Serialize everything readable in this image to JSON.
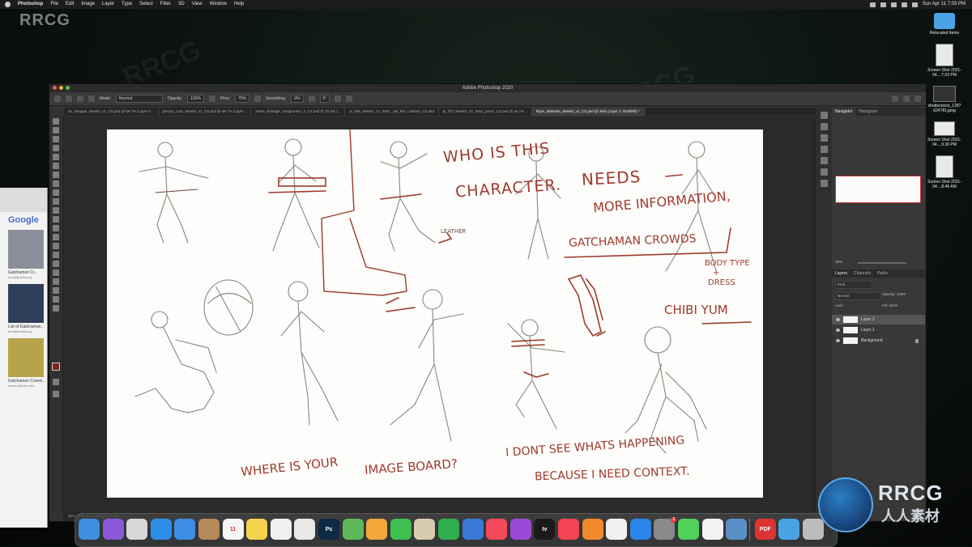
{
  "menubar": {
    "app_name": "Photoshop",
    "items": [
      "File",
      "Edit",
      "Image",
      "Layer",
      "Type",
      "Select",
      "Filter",
      "3D",
      "View",
      "Window",
      "Help"
    ],
    "clock": "Sun Apr 11  7:03 PM"
  },
  "watermark": {
    "corner": "RRCG",
    "repeat": "RRCG"
  },
  "desktop": {
    "icons": [
      {
        "label": "Relocated Items",
        "kind": "folder"
      },
      {
        "label": "Screen Shot 2021-04....7.03 PM",
        "kind": "image"
      },
      {
        "label": "shutterstock_1287 624781.jpeg",
        "kind": "image"
      },
      {
        "label": "Screen Shot 2021-04....9.36 PM",
        "kind": "image"
      },
      {
        "label": "Screen Shot 2021-04....8.46 AM",
        "kind": "image"
      }
    ]
  },
  "browser": {
    "logo": "Google",
    "results": [
      {
        "title": "Gatchaman Cr...",
        "source": "en.wikipedia.org"
      },
      {
        "title": "List of Gatchaman...",
        "source": "en.wikipedia.org"
      },
      {
        "title": "Gatchaman Crowd...",
        "source": "anime-planet.com"
      }
    ]
  },
  "photoshop": {
    "window_title": "Adobe Photoshop 2020",
    "options": {
      "mode_label": "Mode:",
      "mode_value": "Normal",
      "opacity_label": "Opacity:",
      "opacity_value": "100%",
      "flow_label": "Flow:",
      "flow_value": "75%",
      "smoothing_label": "Smoothing:",
      "smoothing_value": "0%",
      "angle_value": "0°"
    },
    "tabs": [
      {
        "label": "4a_Reagan_Week2_v1_CS.psd @ 66.7% (Layer 0...",
        "active": false
      },
      {
        "label": "jessica_Lara_Week2_v1_CS.psd @ 66.7% (Layer...",
        "active": false
      },
      {
        "label": "Jesse_Eldridge_Assignment_4_CS.psd @ 33.3% (...",
        "active": false
      },
      {
        "label": "je_Ella_Week2_V1_0001_call_this_Untitled_CS.psd",
        "active": false
      },
      {
        "label": "je_Ohi_Week2_V1_0001_jason_CS.psd @ 66.7%...",
        "active": false
      },
      {
        "label": "Ryan_Makaela_Week2_v1_CS.psd @ 39% (Layer 2, RGB/8#) *",
        "active": true
      }
    ],
    "status": "39%      1944 px x 1944 px (72 ppi)",
    "panels": {
      "top_tabs": [
        "Navigator",
        "Histogram"
      ],
      "zoom_value": "39%",
      "layer_tabs": [
        "Layers",
        "Channels",
        "Paths"
      ],
      "kind_label": "Kind",
      "blend_mode": "Normal",
      "opacity_label": "Opacity:",
      "opacity_value": "100%",
      "lock_label": "Lock:",
      "fill_label": "Fill:",
      "fill_value": "100%",
      "layers": [
        {
          "name": "Layer 2",
          "selected": true
        },
        {
          "name": "Layer 1",
          "selected": false
        },
        {
          "name": "Background",
          "selected": false
        }
      ]
    }
  },
  "canvas": {
    "notes": [
      "WHO IS THIS",
      "CHARACTER.",
      "NEEDS",
      "MORE INFORMATION,",
      "GATCHAMAN CROWDS",
      "BODY TYPE",
      "+",
      "DRESS",
      "CHIBI YUM",
      "LEATHER",
      "WHERE IS YOUR",
      "IMAGE BOARD?",
      "I DONT SEE WHATS HAPPENING",
      "BECAUSE I NEED CONTEXT."
    ],
    "ink_color": "#9e3a2c",
    "sketch_color": "#8a8580"
  },
  "dock": {
    "apps": [
      {
        "name": "finder-icon",
        "glyph": "",
        "color": "#3d8fe0"
      },
      {
        "name": "siri-icon",
        "glyph": "",
        "color": "#8a5ad8"
      },
      {
        "name": "launchpad-icon",
        "glyph": "",
        "color": "#d7d7d7"
      },
      {
        "name": "safari-icon",
        "glyph": "",
        "color": "#2e8fe8"
      },
      {
        "name": "mail-icon",
        "glyph": "",
        "color": "#3c8ee8"
      },
      {
        "name": "contacts-icon",
        "glyph": "",
        "color": "#b48a5a"
      },
      {
        "name": "calendar-icon",
        "glyph": "11",
        "color": "#f5f5f5"
      },
      {
        "name": "notes-icon",
        "glyph": "",
        "color": "#f4d34c"
      },
      {
        "name": "reminders-icon",
        "glyph": "",
        "color": "#f0f0f0"
      },
      {
        "name": "chrome-icon",
        "glyph": "",
        "color": "#e8e8e8"
      },
      {
        "name": "photoshop-icon",
        "glyph": "Ps",
        "color": "#0f2a44"
      },
      {
        "name": "maps-icon",
        "glyph": "",
        "color": "#5db85a"
      },
      {
        "name": "photos-icon",
        "glyph": "",
        "color": "#f3a73b"
      },
      {
        "name": "facetime-icon",
        "glyph": "",
        "color": "#3fbf4f"
      },
      {
        "name": "preview-icon",
        "glyph": "",
        "color": "#d9cbb0"
      },
      {
        "name": "numbers-icon",
        "glyph": "",
        "color": "#2fae4e"
      },
      {
        "name": "keynote-icon",
        "glyph": "",
        "color": "#3a7ad8"
      },
      {
        "name": "music-icon",
        "glyph": "",
        "color": "#f24a5a"
      },
      {
        "name": "podcasts-icon",
        "glyph": "",
        "color": "#9b4ad8"
      },
      {
        "name": "appletv-icon",
        "glyph": "tv",
        "color": "#1b1b1b"
      },
      {
        "name": "news-icon",
        "glyph": "",
        "color": "#f24453"
      },
      {
        "name": "books-icon",
        "glyph": "",
        "color": "#f08a2a"
      },
      {
        "name": "photos-app-icon",
        "glyph": "",
        "color": "#f1f1f1"
      },
      {
        "name": "appstore-icon",
        "glyph": "",
        "color": "#2a86e8"
      },
      {
        "name": "system-prefs-icon",
        "glyph": "",
        "color": "#8a8a8a",
        "badge": "1"
      },
      {
        "name": "messages-icon",
        "glyph": "",
        "color": "#4fd15a"
      },
      {
        "name": "webex-icon",
        "glyph": "",
        "color": "#f2f2f2"
      },
      {
        "name": "downloads-icon",
        "glyph": "",
        "color": "#5b8fc8"
      },
      {
        "name": "pdf-icon",
        "glyph": "PDF",
        "color": "#d33"
      },
      {
        "name": "folder-stack-icon",
        "glyph": "",
        "color": "#4aa3e4"
      },
      {
        "name": "trash-icon",
        "glyph": "",
        "color": "#bcbcbc"
      }
    ]
  },
  "logo": {
    "text": "RRCG",
    "sub": "人人素材"
  }
}
